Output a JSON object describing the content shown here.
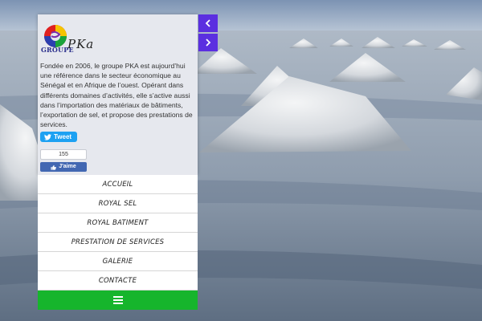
{
  "brand": {
    "groupe": "GROUPE",
    "pka": "PKa"
  },
  "about_text": "Fondée en 2006, le groupe PKA est aujourd’hui une référence dans le secteur économique au Sénégal et en Afrique de l’ouest. Opérant dans différents domaines d’activités, elle s’active aussi dans l’importation des matériaux de bâtiments, l’exportation de sel, et propose des prestations de services.",
  "social": {
    "tweet_label": "Tweet",
    "like_count": "155",
    "like_label": "J'aime"
  },
  "menu": {
    "items": [
      {
        "label": "ACCUEIL"
      },
      {
        "label": "ROYAL SEL"
      },
      {
        "label": "ROYAL BATIMENT"
      },
      {
        "label": "PRESTATION DE SERVICES"
      },
      {
        "label": "GALERIE"
      },
      {
        "label": "CONTACTE"
      }
    ]
  },
  "colors": {
    "arrow_button": "#5b2fe0",
    "menu_toggle": "#16b52c",
    "tweet": "#1da1f2",
    "facebook": "#4267b2"
  },
  "icons": {
    "prev": "chevron-left-icon",
    "next": "chevron-right-icon",
    "menu": "hamburger-icon"
  }
}
